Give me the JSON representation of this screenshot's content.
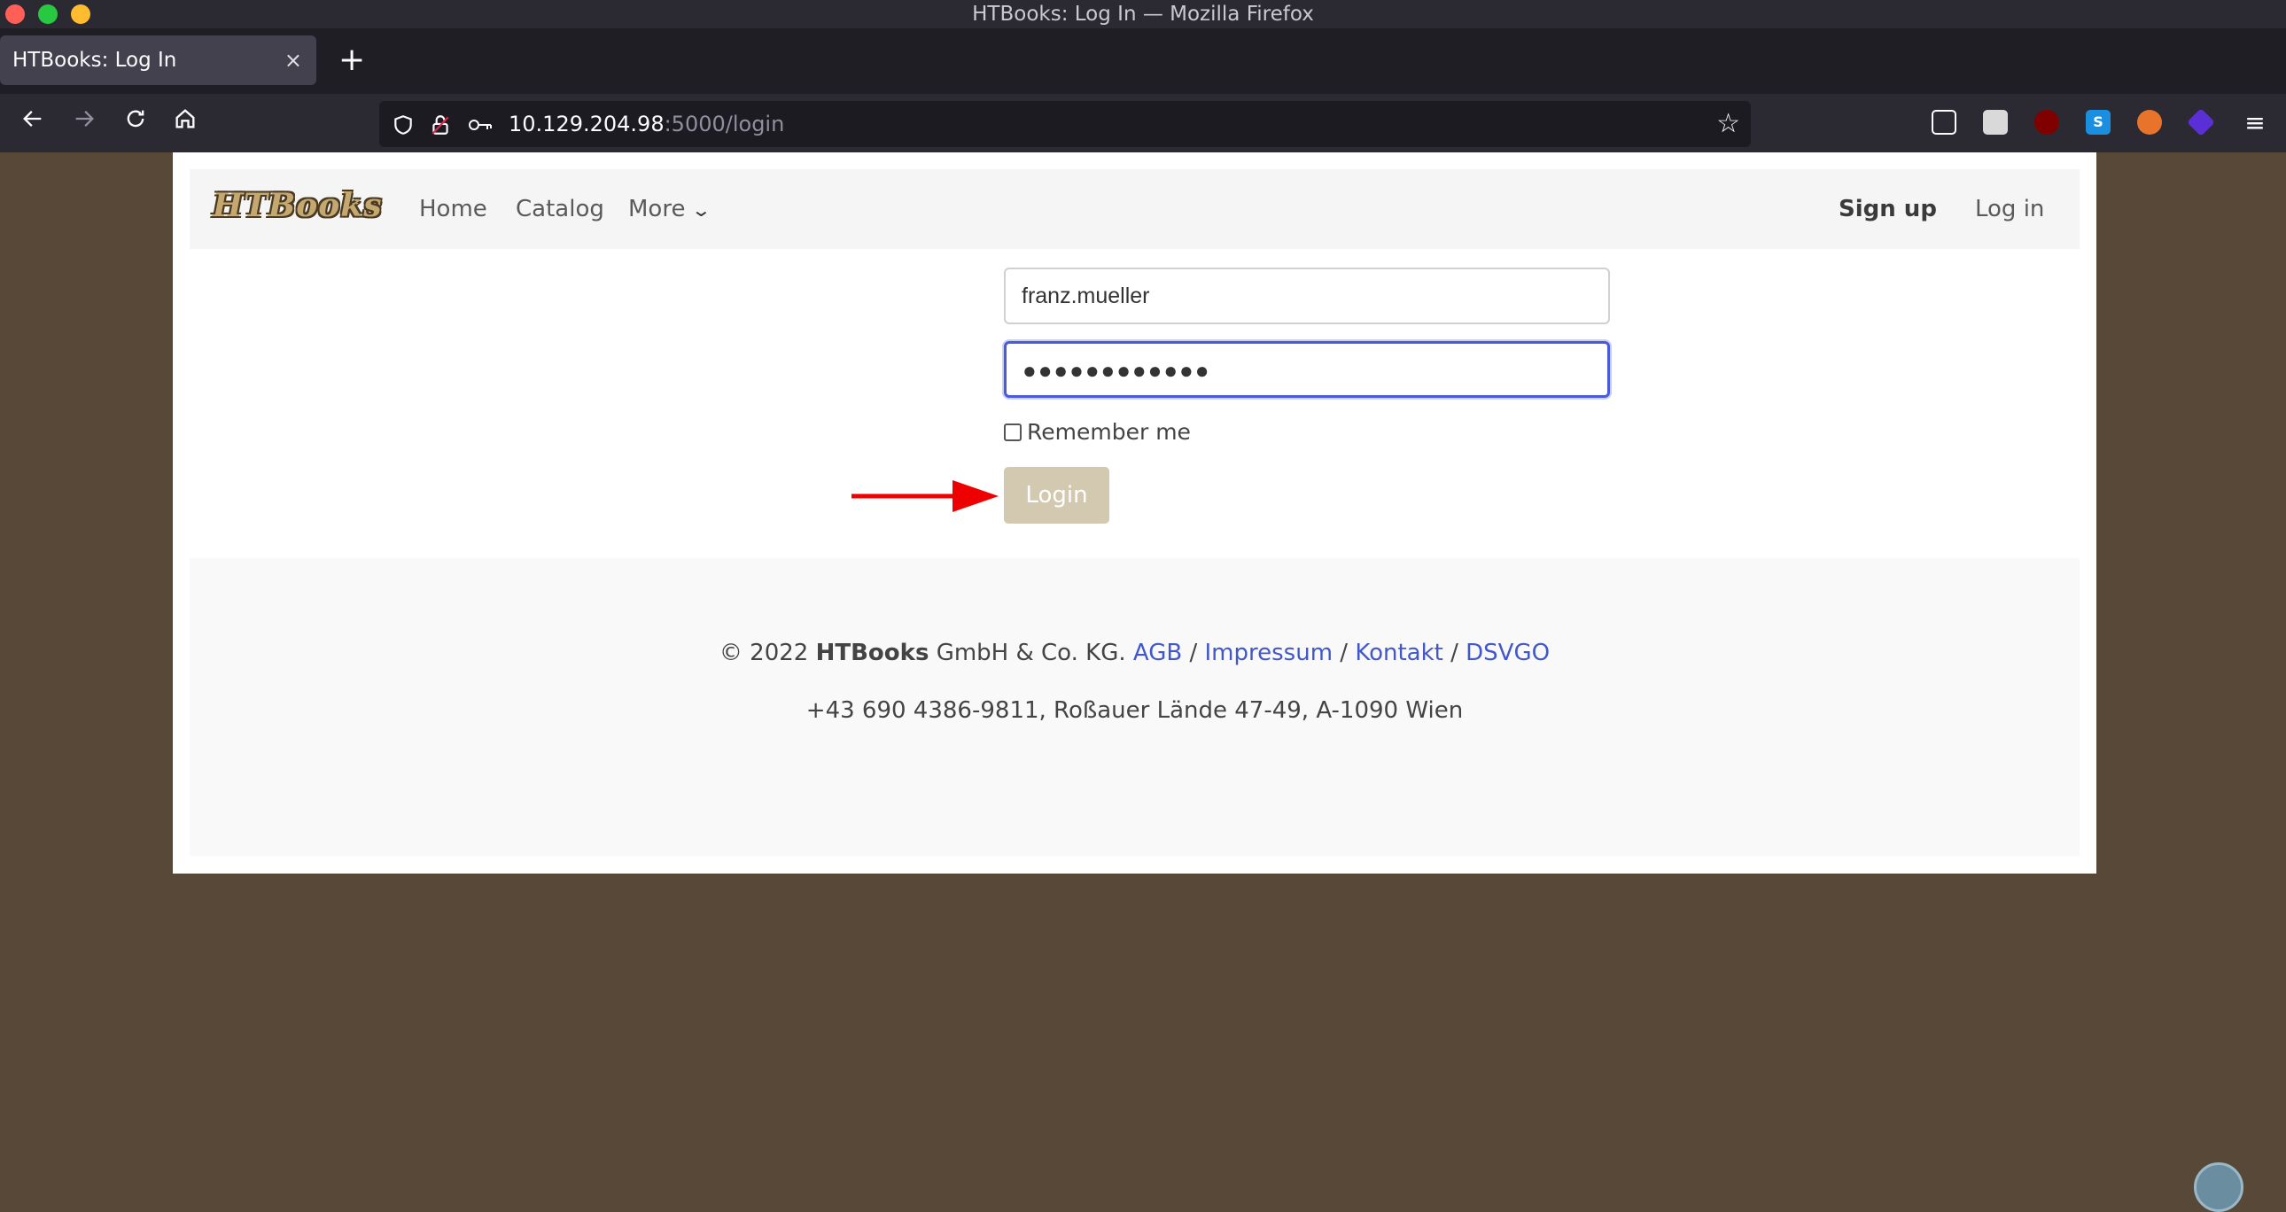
{
  "window": {
    "title": "HTBooks: Log In — Mozilla Firefox"
  },
  "tab": {
    "title": "HTBooks: Log In",
    "close": "×",
    "new_tab": "+"
  },
  "urlbar": {
    "host": "10.129.204.98",
    "path": ":5000/login"
  },
  "site": {
    "logo": "HTBooks",
    "nav": {
      "home": "Home",
      "catalog": "Catalog",
      "more": "More",
      "signup": "Sign up",
      "login": "Log in"
    }
  },
  "form": {
    "username": "franz.mueller",
    "password_mask": "●●●●●●●●●●●●",
    "remember_label": "Remember me",
    "login_button": "Login"
  },
  "footer": {
    "copyright": "© 2022",
    "brand": "HTBooks",
    "company": "GmbH & Co. KG.",
    "links": {
      "agb": "AGB",
      "impressum": "Impressum",
      "kontakt": "Kontakt",
      "dsvgo": "DSVGO"
    },
    "separator": "/",
    "address": "+43 690 4386-9811, Roßauer Lände 47-49, A-1090 Wien"
  }
}
